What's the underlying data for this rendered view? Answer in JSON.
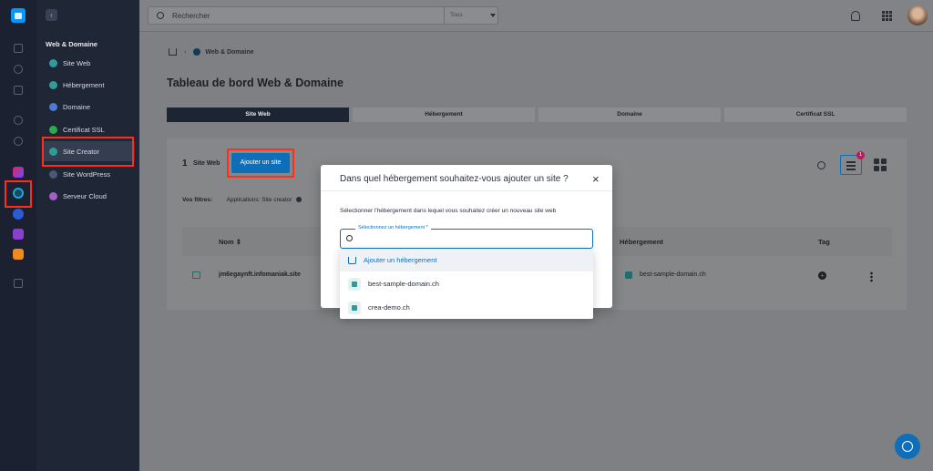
{
  "topbar": {
    "search_placeholder": "Rechercher",
    "search_scope": "Tous"
  },
  "sidebar": {
    "section_title": "Web & Domaine",
    "items": [
      {
        "label": "Site Web",
        "color": "#2e9d9a"
      },
      {
        "label": "Hébergement",
        "color": "#2e9d9a"
      },
      {
        "label": "Domaine",
        "color": "#4b7bd4"
      },
      {
        "label": "Certificat SSL",
        "color": "#2fa84f"
      },
      {
        "label": "Site Creator",
        "color": "#2e9d9a"
      },
      {
        "label": "Site WordPress",
        "color": "#4a5a75"
      },
      {
        "label": "Serveur Cloud",
        "color": "#a05fc9"
      }
    ],
    "active_item": "Site Creator"
  },
  "breadcrumb": {
    "current": "Web & Domaine"
  },
  "page_title": "Tableau de bord Web & Domaine",
  "tabs": [
    "Site Web",
    "Hébergement",
    "Domaine",
    "Certificat SSL"
  ],
  "active_tab": "Site Web",
  "card": {
    "count": "1",
    "count_label": "Site Web",
    "add_button": "Ajouter un site",
    "filters_label": "Vos filtres:",
    "filter_chip": "Applications: Site creator",
    "filter_badge": "1",
    "columns": {
      "name": "Nom",
      "hosting": "Hébergement",
      "tag": "Tag"
    },
    "row": {
      "name": "jm6egaynft.infomaniak.site",
      "hosting": "best-sample-domain.ch"
    }
  },
  "modal": {
    "title": "Dans quel hébergement souhaitez-vous ajouter un site ?",
    "close": "×",
    "description": "Sélectionner l'hébergement dans lequel vous souhaitez créer un nouveau site web",
    "field_label": "Sélectionnez un hébergement *",
    "options": [
      "Ajouter un hébergement",
      "best-sample-domain.ch",
      "crea-demo.ch"
    ]
  },
  "colors": {
    "accent": "#0e6fb8",
    "highlight": "#ff2d1a",
    "sidebar_bg": "#1f2636"
  }
}
